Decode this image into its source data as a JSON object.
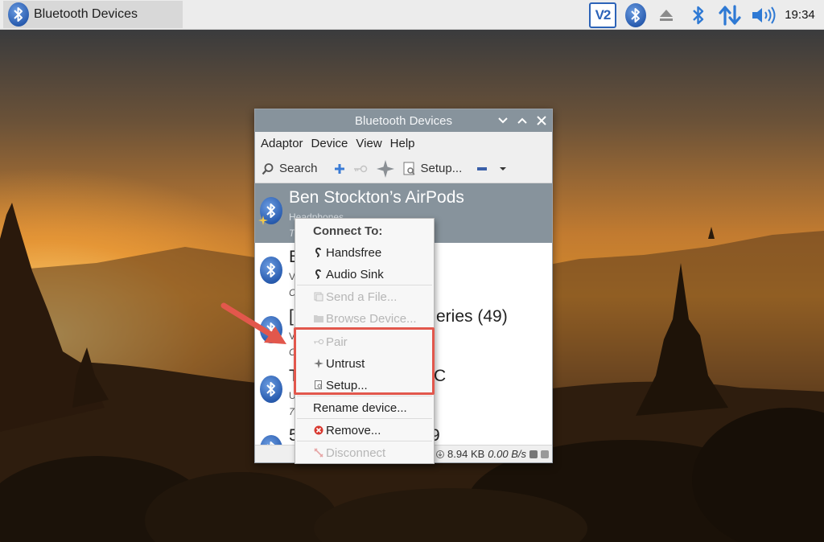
{
  "panel": {
    "task_label": "Bluetooth Devices",
    "vnc_label": "V2",
    "clock": "19:34",
    "tray_icons": [
      "vnc-icon",
      "bluetooth-icon",
      "eject-icon",
      "bluetooth-icon",
      "network-icon",
      "volume-icon"
    ]
  },
  "window": {
    "title": "Bluetooth Devices",
    "menu": [
      "Adaptor",
      "Device",
      "View",
      "Help"
    ],
    "toolbar": {
      "search_label": "Search",
      "setup_label": "Setup..."
    },
    "devices": [
      {
        "name": "Ben Stockton’s AirPods",
        "sub1": "Headphones",
        "sub2": "T",
        "selected": true
      },
      {
        "name": "B",
        "sub1": "V",
        "sub2": "C",
        "selected": false
      },
      {
        "name": "[",
        "suffix": "eries (49)",
        "sub1": "V",
        "sub2": "C",
        "selected": false
      },
      {
        "name": "T",
        "suffix": "C",
        "sub1": "U",
        "sub2": "7",
        "selected": false
      },
      {
        "name": "5",
        "suffix": "9",
        "sub1": "",
        "sub2": "",
        "selected": false
      }
    ],
    "status": {
      "left_fragment": "s",
      "received": "8.94 KB",
      "rate": "0.00 B/s"
    }
  },
  "context_menu": {
    "header": "Connect To:",
    "items": [
      {
        "label": "Handsfree",
        "icon": "ear-icon",
        "disabled": false
      },
      {
        "label": "Audio Sink",
        "icon": "ear-icon",
        "disabled": false
      },
      {
        "label": "Send a File...",
        "icon": "send-file-icon",
        "disabled": true
      },
      {
        "label": "Browse Device...",
        "icon": "folder-icon",
        "disabled": true
      },
      {
        "label": "Pair",
        "icon": "key-icon",
        "disabled": true
      },
      {
        "label": "Untrust",
        "icon": "trust-star-icon",
        "disabled": false
      },
      {
        "label": "Setup...",
        "icon": "setup-icon",
        "disabled": false
      },
      {
        "label": "Rename device...",
        "icon": "",
        "disabled": false
      },
      {
        "label": "Remove...",
        "icon": "remove-icon",
        "disabled": false
      },
      {
        "label": "Disconnect",
        "icon": "disconnect-icon",
        "disabled": true
      }
    ]
  },
  "annotation": {
    "color": "#e2574c"
  }
}
